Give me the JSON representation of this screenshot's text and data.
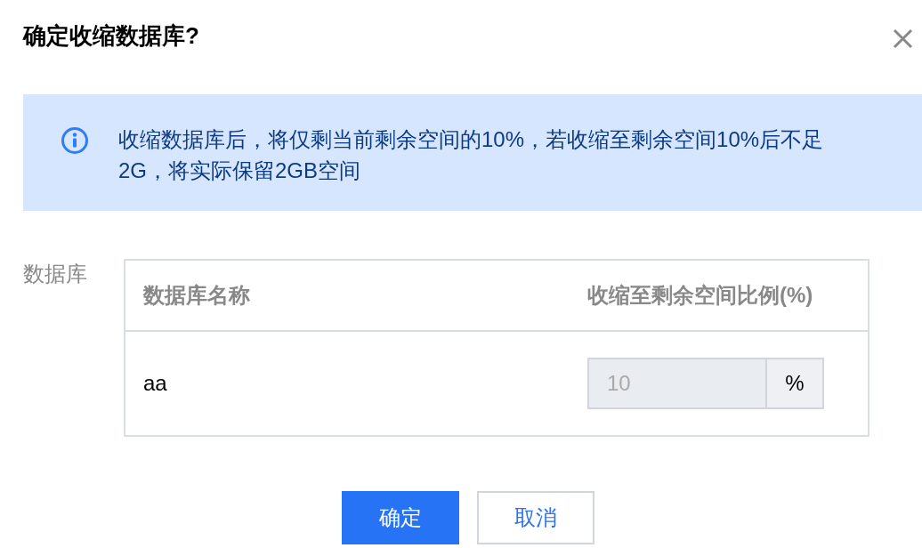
{
  "dialog": {
    "title": "确定收缩数据库?"
  },
  "notice": {
    "kind": "info",
    "text": "收缩数据库后，将仅剩当前剩余空间的10%，若收缩至剩余空间10%后不足2G，将实际保留2GB空间"
  },
  "form": {
    "label": "数据库",
    "table": {
      "columns": [
        "数据库名称",
        "收缩至剩余空间比例(%)"
      ],
      "rows": [
        {
          "name": "aa",
          "ratio": {
            "value": "10",
            "unit": "%",
            "disabled": true
          }
        }
      ]
    }
  },
  "buttons": [
    {
      "label": "确定",
      "kind": "primary"
    },
    {
      "label": "取消",
      "kind": "secondary"
    }
  ]
}
